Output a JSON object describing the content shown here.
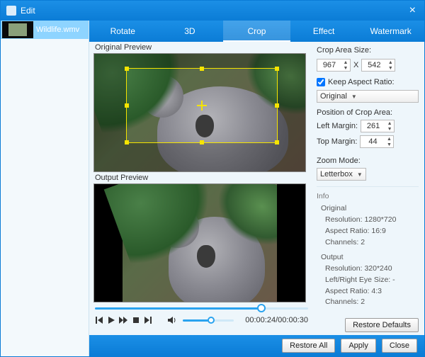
{
  "window": {
    "title": "Edit"
  },
  "sidebar": {
    "items": [
      {
        "filename": "Wildlife.wmv"
      }
    ]
  },
  "tabs": [
    {
      "label": "Rotate"
    },
    {
      "label": "3D"
    },
    {
      "label": "Crop"
    },
    {
      "label": "Effect"
    },
    {
      "label": "Watermark"
    }
  ],
  "active_tab": 2,
  "preview": {
    "original_label": "Original Preview",
    "output_label": "Output Preview",
    "crop_rect": {
      "left_pct": 15,
      "top_pct": 12,
      "width_pct": 72,
      "height_pct": 64
    }
  },
  "transport": {
    "seek_pct": 78,
    "volume_pct": 55,
    "time_current": "00:00:24",
    "time_total": "00:00:30"
  },
  "props": {
    "crop_size_label": "Crop Area Size:",
    "crop_width": "967",
    "x_label": "X",
    "crop_height": "542",
    "keep_aspect_label": "Keep Aspect Ratio:",
    "keep_aspect_checked": true,
    "aspect_select": "Original",
    "position_label": "Position of Crop Area:",
    "left_margin_label": "Left Margin:",
    "left_margin": "261",
    "top_margin_label": "Top Margin:",
    "top_margin": "44",
    "zoom_label": "Zoom Mode:",
    "zoom_select": "Letterbox"
  },
  "info": {
    "heading": "Info",
    "original_label": "Original",
    "original_resolution_label": "Resolution:",
    "original_resolution": "1280*720",
    "original_aspect_label": "Aspect Ratio:",
    "original_aspect": "16:9",
    "original_channels_label": "Channels:",
    "original_channels": "2",
    "output_label": "Output",
    "output_resolution_label": "Resolution:",
    "output_resolution": "320*240",
    "output_eyesize_label": "Left/Right Eye Size:",
    "output_eyesize": "-",
    "output_aspect_label": "Aspect Ratio:",
    "output_aspect": "4:3",
    "output_channels_label": "Channels:",
    "output_channels": "2"
  },
  "buttons": {
    "restore_defaults": "Restore Defaults",
    "restore_all": "Restore All",
    "apply": "Apply",
    "close": "Close"
  }
}
